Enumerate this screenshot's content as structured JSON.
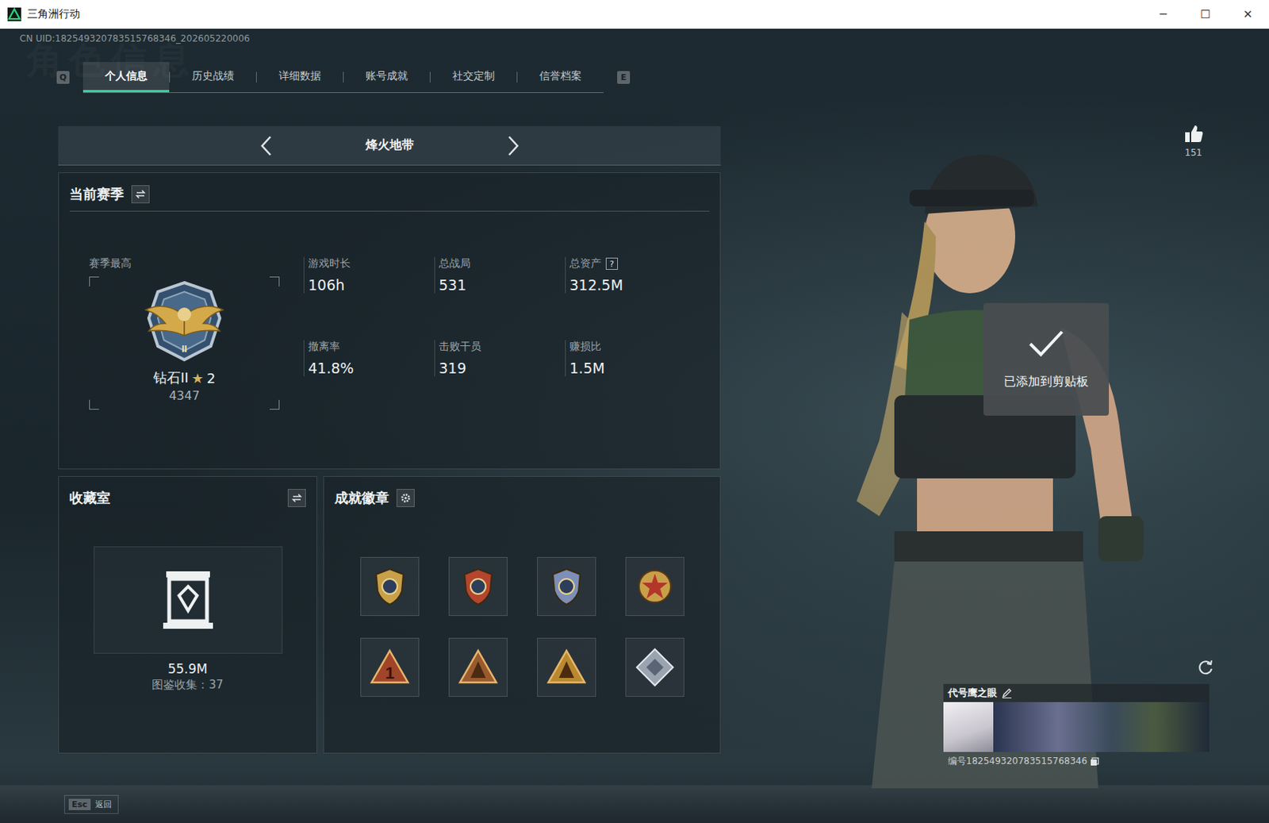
{
  "window": {
    "title": "三角洲行动",
    "controls": [
      "─",
      "☐",
      "✕"
    ]
  },
  "uid": "CN UID:182549320783515768346_202605220006",
  "watermark": "角色信息",
  "tabs": {
    "prev_key": "Q",
    "next_key": "E",
    "items": [
      {
        "label": "个人信息",
        "selected": true
      },
      {
        "label": "历史战绩",
        "selected": false
      },
      {
        "label": "详细数据",
        "selected": false
      },
      {
        "label": "账号成就",
        "selected": false
      },
      {
        "label": "社交定制",
        "selected": false
      },
      {
        "label": "信誉档案",
        "selected": false
      }
    ]
  },
  "mode": {
    "label": "烽火地带"
  },
  "season": {
    "title": "当前赛季",
    "best_label": "赛季最高",
    "badge_mark": "II",
    "rank": "钻石II",
    "star": "★",
    "star_count": "2",
    "score": "4347",
    "stats": [
      {
        "label": "游戏时长",
        "value": "106h"
      },
      {
        "label": "总战局",
        "value": "531"
      },
      {
        "label": "总资产",
        "value": "312.5M",
        "help": "?"
      },
      {
        "label": "撤离率",
        "value": "41.8%"
      },
      {
        "label": "击败干员",
        "value": "319"
      },
      {
        "label": "赚损比",
        "value": "1.5M"
      }
    ]
  },
  "collection": {
    "title": "收藏室",
    "value": "55.9M",
    "caption": "图鉴收集：37"
  },
  "achievements": {
    "title": "成就徽章",
    "badges": [
      {
        "kind": "shield",
        "color": "#c9a04a"
      },
      {
        "kind": "shield",
        "color": "#b5452e"
      },
      {
        "kind": "shield",
        "color": "#7d8fb8"
      },
      {
        "kind": "star",
        "color": "#c9a04a"
      },
      {
        "kind": "triangle",
        "color": "#a0452a",
        "mark": "1"
      },
      {
        "kind": "triangle",
        "color": "#9a5a30"
      },
      {
        "kind": "triangle",
        "color": "#b8892f"
      },
      {
        "kind": "diamond",
        "color": "#9aa3b0"
      }
    ]
  },
  "character": {
    "likes": "151",
    "codename": "代号鹰之眼",
    "id_label": "编号182549320783515768346"
  },
  "toast": {
    "text": "已添加到剪贴板"
  },
  "footer": {
    "key": "Esc",
    "label": "返回"
  }
}
